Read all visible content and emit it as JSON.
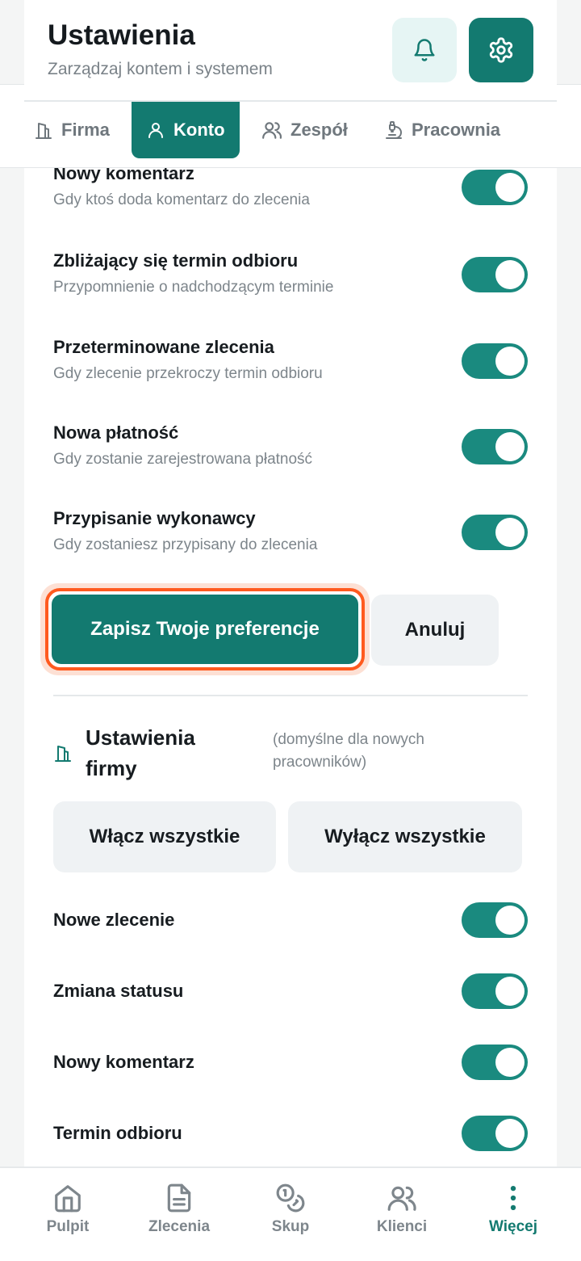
{
  "header": {
    "title": "Ustawienia",
    "subtitle": "Zarządzaj kontem i systemem",
    "bell_icon": "bell-icon",
    "settings_icon": "gear-icon"
  },
  "tabs": [
    {
      "label": "Firma",
      "icon": "building-icon",
      "active": false
    },
    {
      "label": "Konto",
      "icon": "user-icon",
      "active": true
    },
    {
      "label": "Zespół",
      "icon": "users-icon",
      "active": false
    },
    {
      "label": "Pracownia",
      "icon": "microscope-icon",
      "active": false
    }
  ],
  "personal_notifications": [
    {
      "title": "Nowy komentarz",
      "desc": "Gdy ktoś doda komentarz do zlecenia",
      "enabled": true
    },
    {
      "title": "Zbliżający się termin odbioru",
      "desc": "Przypomnienie o nadchodzącym terminie",
      "enabled": true
    },
    {
      "title": "Przeterminowane zlecenia",
      "desc": "Gdy zlecenie przekroczy termin odbioru",
      "enabled": true
    },
    {
      "title": "Nowa płatność",
      "desc": "Gdy zostanie zarejestrowana płatność",
      "enabled": true
    },
    {
      "title": "Przypisanie wykonawcy",
      "desc": "Gdy zostaniesz przypisany do zlecenia",
      "enabled": true
    }
  ],
  "actions": {
    "save_label": "Zapisz Twoje preferencje",
    "cancel_label": "Anuluj"
  },
  "company_section": {
    "title": "Ustawienia firmy",
    "note": "(domyślne dla nowych pracowników)",
    "enable_all_label": "Włącz wszystkie",
    "disable_all_label": "Wyłącz wszystkie",
    "items": [
      {
        "title": "Nowe zlecenie",
        "enabled": true
      },
      {
        "title": "Zmiana statusu",
        "enabled": true
      },
      {
        "title": "Nowy komentarz",
        "enabled": true
      },
      {
        "title": "Termin odbioru",
        "enabled": true
      }
    ]
  },
  "bottom_nav": [
    {
      "label": "Pulpit",
      "icon": "home-icon",
      "active": false
    },
    {
      "label": "Zlecenia",
      "icon": "document-icon",
      "active": false
    },
    {
      "label": "Skup",
      "icon": "coins-icon",
      "active": false
    },
    {
      "label": "Klienci",
      "icon": "users-icon",
      "active": false
    },
    {
      "label": "Więcej",
      "icon": "more-vertical-icon",
      "active": true
    }
  ],
  "colors": {
    "accent": "#137a70",
    "toggle_on": "#1a8a7f",
    "focus_ring": "#ff5a1f"
  }
}
